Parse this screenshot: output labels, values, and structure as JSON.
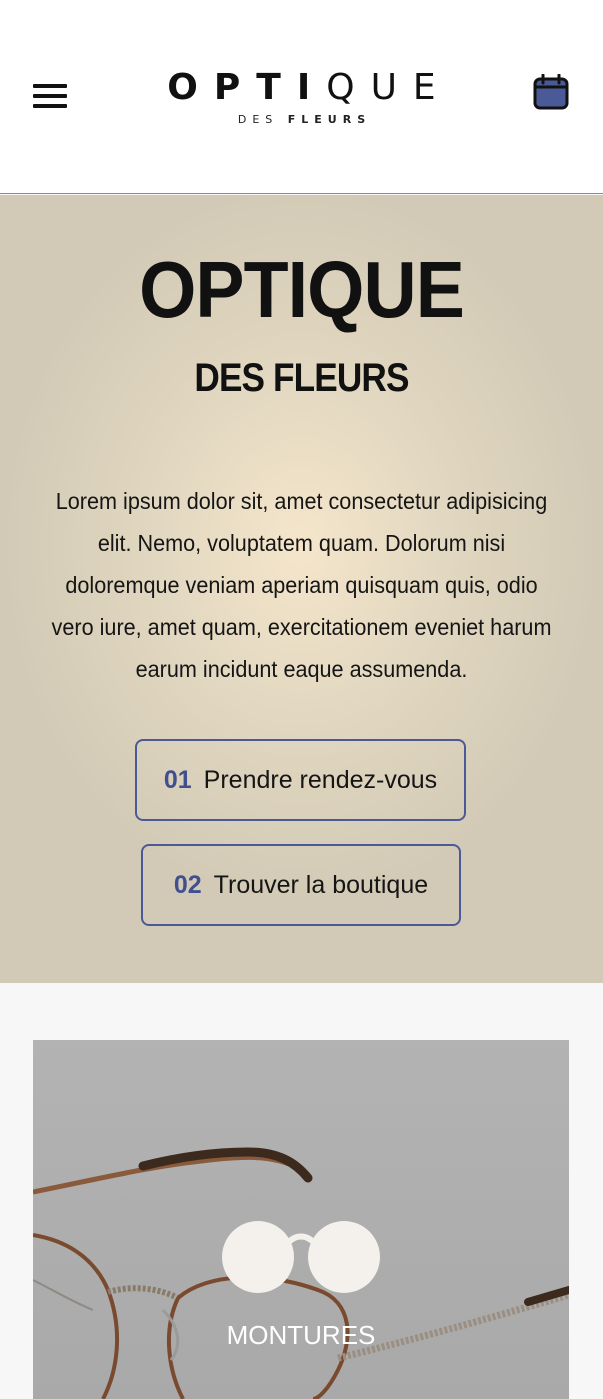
{
  "header": {
    "menu_icon": "hamburger-menu-icon",
    "logo": {
      "main_bold": "OPTI",
      "main_light": "QUE",
      "sub_light": "DES",
      "sub_bold": "FLEURS"
    },
    "calendar_icon": "calendar-icon",
    "calendar_color": "#4a5a96"
  },
  "hero": {
    "title": "OPTIQUE",
    "subtitle": "DES FLEURS",
    "text": "Lorem ipsum dolor sit, amet consectetur adipisicing elit. Nemo, voluptatem quam. Dolorum nisi doloremque veniam aperiam quisquam quis, odio vero iure, amet quam, exercitationem eveniet harum earum incidunt eaque assumenda.",
    "buttons": [
      {
        "number": "01",
        "label": "Prendre rendez-vous"
      },
      {
        "number": "02",
        "label": "Trouver la boutique"
      }
    ],
    "accent_color": "#4a5a96"
  },
  "card": {
    "icon": "glasses-icon",
    "label": "MONTURES"
  }
}
